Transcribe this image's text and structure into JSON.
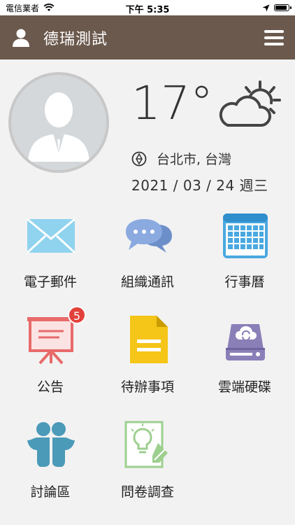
{
  "status_bar": {
    "carrier": "電信業者",
    "time": "下午 5:35"
  },
  "header": {
    "title": "德瑞測試"
  },
  "weather": {
    "temperature": "17°",
    "location": "台北市, 台灣",
    "date": "2021 / 03 / 24 週三",
    "condition_icon": "partly-cloudy-icon"
  },
  "apps": [
    {
      "label": "電子郵件",
      "icon": "mail-icon"
    },
    {
      "label": "組織通訊",
      "icon": "chat-icon"
    },
    {
      "label": "行事曆",
      "icon": "calendar-icon"
    },
    {
      "label": "公告",
      "icon": "announcement-board-icon",
      "badge": "5"
    },
    {
      "label": "待辦事項",
      "icon": "todo-document-icon"
    },
    {
      "label": "雲端硬碟",
      "icon": "cloud-drive-icon"
    },
    {
      "label": "討論區",
      "icon": "discussion-people-icon"
    },
    {
      "label": "問卷調查",
      "icon": "survey-icon"
    }
  ],
  "colors": {
    "header_bg": "#6b594d",
    "page_bg": "#f2f2f2",
    "badge": "#e2413b",
    "mail": "#8fd3ee",
    "chat": "#7fa0d8",
    "calendar": "#4aa8e0",
    "announcement": "#e86a6a",
    "todo": "#f5c518",
    "drive": "#8b7fb8",
    "discussion": "#4a9ab8",
    "survey": "#9dcf8f"
  }
}
